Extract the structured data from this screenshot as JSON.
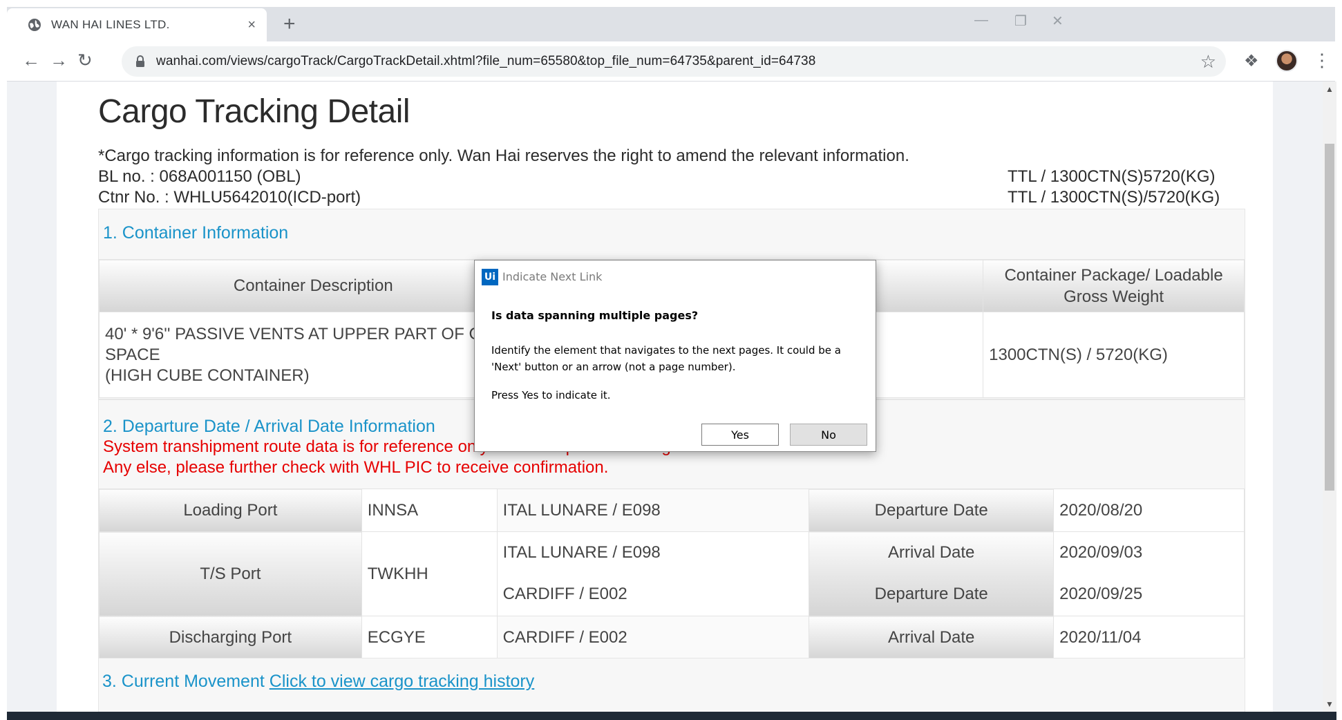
{
  "browser": {
    "tab_title": "WAN HAI LINES LTD.",
    "tab_close": "×",
    "new_tab": "+",
    "url": "wanhai.com/views/cargoTrack/CargoTrackDetail.xhtml?file_num=65580&top_file_num=64735&parent_id=64738",
    "window_controls": [
      "—",
      "❐",
      "✕"
    ]
  },
  "page": {
    "title": "Cargo Tracking Detail",
    "disclaimer": "*Cargo tracking information is for reference only. Wan Hai reserves the right to amend the relevant information.",
    "bl_no": "BL no. : 068A001150 (OBL)",
    "ctnr_no": "Ctnr No. : WHLU5642010(ICD-port)",
    "ttl_1": "TTL / 1300CTN(S)5720(KG)",
    "ttl_2": "TTL / 1300CTN(S)/5720(KG)"
  },
  "container_info": {
    "section_title": "1. Container Information",
    "col_description": "Container Description",
    "col_package": "Container Package/ Loadable Gross Weight",
    "description_line1": "40' * 9'6'' PASSIVE VENTS AT UPPER PART OF CARG",
    "description_line2": "SPACE",
    "description_line3": "(HIGH CUBE CONTAINER)",
    "package_value": "1300CTN(S) / 5720(KG)"
  },
  "departure_arrival": {
    "section_title": "2. Departure Date / Arrival Date Information",
    "notice_line1": "System transhipment route data is for reference only before shipment arriving destination.",
    "notice_line2": "Any else, please further check with WHL PIC to receive confirmation.",
    "rows": [
      {
        "port_label": "Loading Port",
        "port_code": "INNSA",
        "vessel": "ITAL LUNARE / E098",
        "date_label": "Departure Date",
        "date": "2020/08/20"
      },
      {
        "port_label": "T/S Port",
        "port_code": "TWKHH",
        "vessel": "ITAL LUNARE / E098",
        "date_label": "Arrival Date",
        "date": "2020/09/03"
      },
      {
        "vessel": "CARDIFF / E002",
        "date_label": "Departure Date",
        "date": "2020/09/25"
      },
      {
        "port_label": "Discharging Port",
        "port_code": "ECGYE",
        "vessel": "CARDIFF / E002",
        "date_label": "Arrival Date",
        "date": "2020/11/04"
      }
    ]
  },
  "current_movement": {
    "section_title": "3. Current Movement",
    "link_text": "Click to view cargo tracking history"
  },
  "dialog": {
    "icon_text": "Ui",
    "title": "Indicate Next Link",
    "question": "Is data spanning multiple pages?",
    "body": "Identify the element that navigates to the next pages. It could be a 'Next' button or an arrow (not a page number).",
    "press": "Press Yes to indicate it.",
    "yes_label": "Yes",
    "no_label": "No"
  }
}
